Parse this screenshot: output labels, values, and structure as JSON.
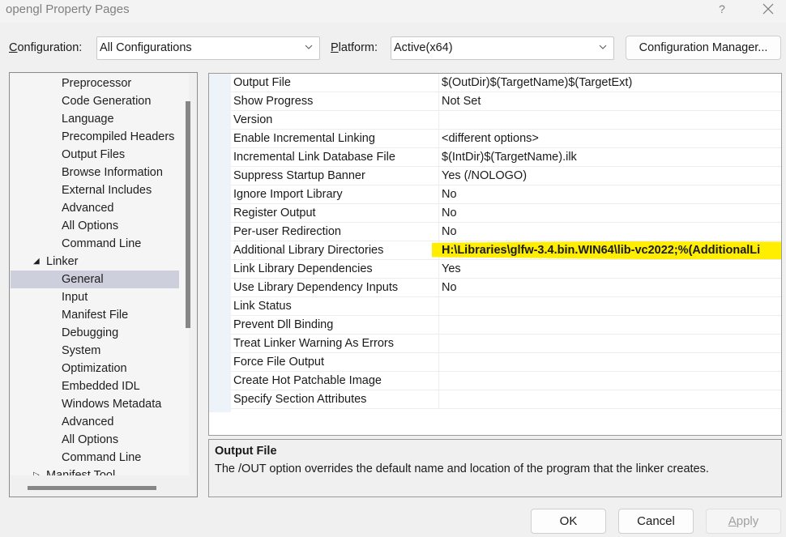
{
  "window": {
    "title": "opengl Property Pages",
    "help_label": "?",
    "close_icon": "close-icon"
  },
  "config_bar": {
    "configuration_label_accel": "C",
    "configuration_label_rest": "onfiguration:",
    "configuration_value": "All Configurations",
    "platform_label_accel": "P",
    "platform_label_rest": "latform:",
    "platform_value": "Active(x64)",
    "config_manager_label": "Configuration Manager..."
  },
  "tree": {
    "items": [
      {
        "label": "Preprocessor",
        "level": 2
      },
      {
        "label": "Code Generation",
        "level": 2
      },
      {
        "label": "Language",
        "level": 2
      },
      {
        "label": "Precompiled Headers",
        "level": 2
      },
      {
        "label": "Output Files",
        "level": 2
      },
      {
        "label": "Browse Information",
        "level": 2
      },
      {
        "label": "External Includes",
        "level": 2
      },
      {
        "label": "Advanced",
        "level": 2
      },
      {
        "label": "All Options",
        "level": 2
      },
      {
        "label": "Command Line",
        "level": 2
      },
      {
        "label": "Linker",
        "level": 1,
        "expander": "expanded"
      },
      {
        "label": "General",
        "level": 2,
        "selected": true
      },
      {
        "label": "Input",
        "level": 2
      },
      {
        "label": "Manifest File",
        "level": 2
      },
      {
        "label": "Debugging",
        "level": 2
      },
      {
        "label": "System",
        "level": 2
      },
      {
        "label": "Optimization",
        "level": 2
      },
      {
        "label": "Embedded IDL",
        "level": 2
      },
      {
        "label": "Windows Metadata",
        "level": 2
      },
      {
        "label": "Advanced",
        "level": 2
      },
      {
        "label": "All Options",
        "level": 2
      },
      {
        "label": "Command Line",
        "level": 2
      },
      {
        "label": "Manifest Tool",
        "level": 1,
        "expander": "collapsed"
      }
    ]
  },
  "properties": {
    "rows": [
      {
        "name": "Output File",
        "value": "$(OutDir)$(TargetName)$(TargetExt)"
      },
      {
        "name": "Show Progress",
        "value": "Not Set"
      },
      {
        "name": "Version",
        "value": ""
      },
      {
        "name": "Enable Incremental Linking",
        "value": "<different options>"
      },
      {
        "name": "Incremental Link Database File",
        "value": "$(IntDir)$(TargetName).ilk"
      },
      {
        "name": "Suppress Startup Banner",
        "value": "Yes (/NOLOGO)"
      },
      {
        "name": "Ignore Import Library",
        "value": "No"
      },
      {
        "name": "Register Output",
        "value": "No"
      },
      {
        "name": "Per-user Redirection",
        "value": "No"
      },
      {
        "name": "Additional Library Directories",
        "value": "H:\\Libraries\\glfw-3.4.bin.WIN64\\lib-vc2022;%(AdditionalLi",
        "highlighted": true,
        "highlight_color": "#ffee00"
      },
      {
        "name": "Link Library Dependencies",
        "value": "Yes"
      },
      {
        "name": "Use Library Dependency Inputs",
        "value": "No"
      },
      {
        "name": "Link Status",
        "value": ""
      },
      {
        "name": "Prevent Dll Binding",
        "value": ""
      },
      {
        "name": "Treat Linker Warning As Errors",
        "value": ""
      },
      {
        "name": "Force File Output",
        "value": ""
      },
      {
        "name": "Create Hot Patchable Image",
        "value": ""
      },
      {
        "name": "Specify Section Attributes",
        "value": ""
      }
    ]
  },
  "description": {
    "title": "Output File",
    "text": "The /OUT option overrides the default name and location of the program that the linker creates."
  },
  "buttons": {
    "ok": "OK",
    "cancel": "Cancel",
    "apply_accel": "A",
    "apply_rest": "pply"
  },
  "colors": {
    "selection": "#cdd0dc",
    "highlight": "#ffee00"
  }
}
